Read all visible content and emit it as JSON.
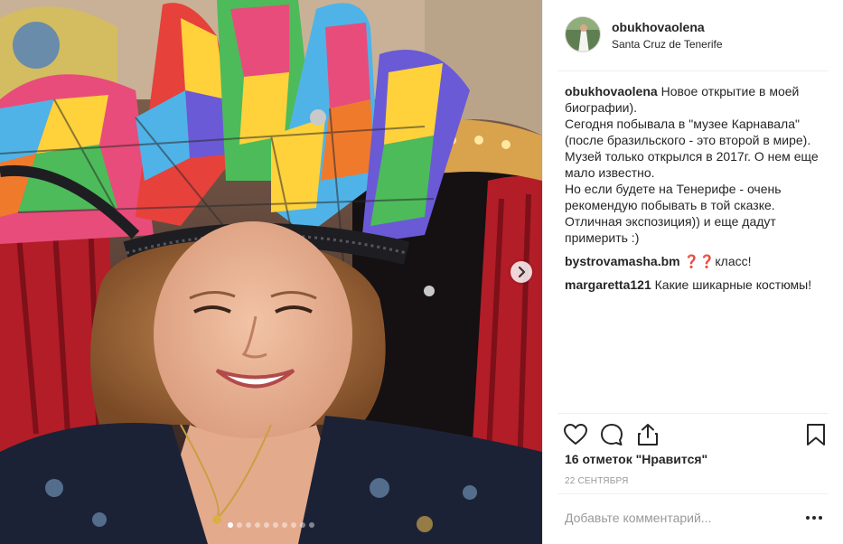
{
  "post": {
    "username": "obukhovaolena",
    "location": "Santa Cruz de Tenerife",
    "caption": "Новое открытие в моей биографии).\nСегодня побывала в \"музее Карнавала\" (после бразильского - это второй в мире).\nМузей только открылся в 2017г. О нем еще мало известно.\nНо если будете на Тенерифе - очень рекомендую побывать в той сказке. Отличная экспозиция)) и еще дадут примерить :)",
    "comments": [
      {
        "user": "bystrovamasha.bm",
        "text": "❓❓класс!"
      },
      {
        "user": "margaretta121",
        "text": "Какие шикарные костюмы!"
      }
    ],
    "likes": "16 отметок \"Нравится\"",
    "date": "22 сентября",
    "comment_placeholder": "Добавьте комментарий...",
    "carousel": {
      "total": 10,
      "active": 1
    }
  },
  "icons": {
    "next": "chevron-right-icon",
    "like": "heart-icon",
    "comment": "comment-bubble-icon",
    "share": "share-icon",
    "save": "bookmark-icon",
    "more": "more-dots-icon"
  },
  "colors": {
    "text": "#262626",
    "secondary": "#999999",
    "border": "#efefef"
  }
}
